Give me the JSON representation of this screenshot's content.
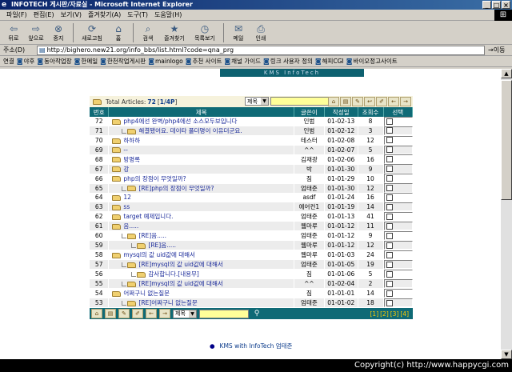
{
  "window": {
    "title": "INFOTECH 게시판/자료실 - Microsoft Internet Explorer",
    "logo_glyph": "⊞"
  },
  "menu": [
    "파일(F)",
    "편집(E)",
    "보기(V)",
    "즐겨찾기(A)",
    "도구(T)",
    "도움말(H)"
  ],
  "toolbar": [
    {
      "icon": "back-arrow",
      "glyph": "⇦",
      "label": "뒤로"
    },
    {
      "icon": "forward-arrow",
      "glyph": "⇨",
      "label": "앞으로"
    },
    {
      "icon": "stop",
      "glyph": "⊗",
      "label": "중지"
    },
    {
      "icon": "refresh",
      "glyph": "⟳",
      "label": "새로고침"
    },
    {
      "icon": "home",
      "glyph": "⌂",
      "label": "홈"
    },
    {
      "icon": "search",
      "glyph": "⌕",
      "label": "검색"
    },
    {
      "icon": "favorites",
      "glyph": "★",
      "label": "즐겨찾기"
    },
    {
      "icon": "history",
      "glyph": "◷",
      "label": "목록보기"
    },
    {
      "icon": "mail",
      "glyph": "✉",
      "label": "메일"
    },
    {
      "icon": "print",
      "glyph": "⎙",
      "label": "인쇄"
    }
  ],
  "address": {
    "label": "주소(D)",
    "value": "http://bighero.new21.org/info_bbs/list.html?code=qna_prg",
    "go": "이동"
  },
  "links": {
    "label": "연결",
    "items": [
      "야후",
      "동아작업장",
      "한메일",
      "한천작업게시판",
      "mainlogo",
      "추천 사이트",
      "채널 가이드",
      "링크 사용자 정의",
      "해피CGI",
      "바이오정고사이트"
    ]
  },
  "banner": "KMS InfoTech",
  "board": {
    "total_label": "Total Articles:",
    "total": "72",
    "page_info": "1/4P",
    "search_select": "제목",
    "search_select2": "제목",
    "columns": [
      "번호",
      "제목",
      "글쓴이",
      "작성일",
      "조회수",
      "선택"
    ],
    "rows": [
      {
        "num": "72",
        "depth": 0,
        "subject": "php4에선 완벽/php4에선 소스모두보입니다",
        "author": "인범",
        "date": "01-02-13",
        "hits": "8"
      },
      {
        "num": "71",
        "depth": 1,
        "subject": "해결됐어요. 데이타 폴더명이 이유더군요.",
        "author": "인범",
        "date": "01-02-12",
        "hits": "3"
      },
      {
        "num": "70",
        "depth": 0,
        "subject": "하하하",
        "author": "테스터",
        "date": "01-02-08",
        "hits": "12"
      },
      {
        "num": "69",
        "depth": 0,
        "subject": "--",
        "author": "^^",
        "date": "01-02-07",
        "hits": "5"
      },
      {
        "num": "68",
        "depth": 0,
        "subject": "방명록",
        "author": "김재광",
        "date": "01-02-06",
        "hits": "16"
      },
      {
        "num": "67",
        "depth": 0,
        "subject": "강",
        "author": "박",
        "date": "01-01-30",
        "hits": "9"
      },
      {
        "num": "66",
        "depth": 0,
        "subject": "php의 장점이 무엇일까?",
        "author": "짐",
        "date": "01-01-29",
        "hits": "10"
      },
      {
        "num": "65",
        "depth": 1,
        "subject": "[RE]php의 장점이 무엇일까?",
        "author": "엄태준",
        "date": "01-01-30",
        "hits": "12"
      },
      {
        "num": "64",
        "depth": 0,
        "subject": "12",
        "author": "asdf",
        "date": "01-01-24",
        "hits": "16"
      },
      {
        "num": "63",
        "depth": 0,
        "subject": "ss",
        "author": "에어컨1",
        "date": "01-01-19",
        "hits": "14"
      },
      {
        "num": "62",
        "depth": 0,
        "subject": "target 예제입니다.",
        "author": "엄태준",
        "date": "01-01-13",
        "hits": "41"
      },
      {
        "num": "61",
        "depth": 0,
        "subject": "음.....",
        "author": "웹마루",
        "date": "01-01-12",
        "hits": "11"
      },
      {
        "num": "60",
        "depth": 1,
        "subject": "[RE]음.....",
        "author": "엄태준",
        "date": "01-01-12",
        "hits": "9"
      },
      {
        "num": "59",
        "depth": 2,
        "subject": "[RE]음.....",
        "author": "웹마루",
        "date": "01-01-12",
        "hits": "12"
      },
      {
        "num": "58",
        "depth": 0,
        "subject": "mysql의 값 uid값에 대해서",
        "author": "웹마루",
        "date": "01-01-03",
        "hits": "24"
      },
      {
        "num": "57",
        "depth": 1,
        "subject": "[RE]mysql의 값 uid값에 대해서",
        "author": "엄태준",
        "date": "01-01-05",
        "hits": "19"
      },
      {
        "num": "56",
        "depth": 2,
        "subject": "감사합니다.[내용무]",
        "author": "짐",
        "date": "01-01-06",
        "hits": "5"
      },
      {
        "num": "55",
        "depth": 1,
        "subject": "[RE]mysql의 값 uid값에 대해서",
        "author": "^^",
        "date": "01-02-04",
        "hits": "2"
      },
      {
        "num": "54",
        "depth": 0,
        "subject": "어쩌구니 없는질문",
        "author": "짐",
        "date": "01-01-01",
        "hits": "14"
      },
      {
        "num": "53",
        "depth": 1,
        "subject": "[RE]어쩌구니 없는질문",
        "author": "엄태준",
        "date": "01-01-02",
        "hits": "18"
      }
    ],
    "pages": [
      "[1]",
      "[2]",
      "[3]",
      "[4]"
    ]
  },
  "credit": "KMS with InfoTech 엄태준",
  "status_copyright": "Copyright(c) http://www.happycgi.com"
}
